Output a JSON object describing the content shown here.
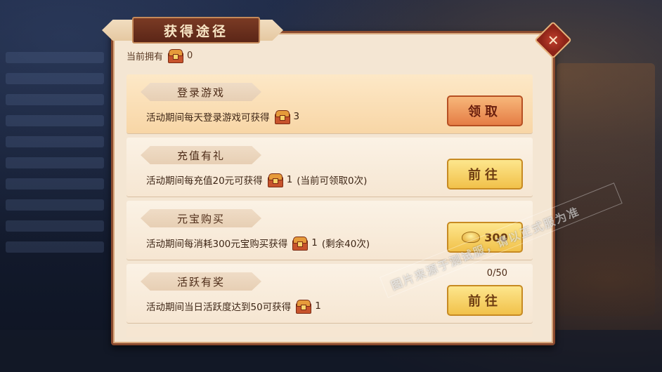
{
  "dialog": {
    "title": "获得途径",
    "close_icon": "close-x-icon",
    "owned_label": "当前拥有",
    "owned_count": "0"
  },
  "items": [
    {
      "name": "登录游戏",
      "desc": "活动期间每天登录游戏可获得",
      "reward": "3",
      "extra": "",
      "button": "领取",
      "button_style": "orange",
      "progress": ""
    },
    {
      "name": "充值有礼",
      "desc": "活动期间每充值20元可获得",
      "reward": "1",
      "extra": "(当前可领取0次)",
      "button": "前往",
      "button_style": "yellow",
      "progress": ""
    },
    {
      "name": "元宝购买",
      "desc": "活动期间每消耗300元宝购买获得",
      "reward": "1",
      "extra": "(剩余40次)",
      "button": "300",
      "button_style": "yellow-gold",
      "progress": ""
    },
    {
      "name": "活跃有奖",
      "desc": "活动期间当日活跃度达到50可获得",
      "reward": "1",
      "extra": "",
      "button": "前往",
      "button_style": "yellow",
      "progress": "0/50"
    }
  ],
  "watermark": "图片来源于测试服，请以正式服为准",
  "colors": {
    "panel": "#f4e6d3",
    "frame": "#8a4a2e",
    "button_orange": "#e57d45",
    "button_yellow": "#f1c14a"
  }
}
